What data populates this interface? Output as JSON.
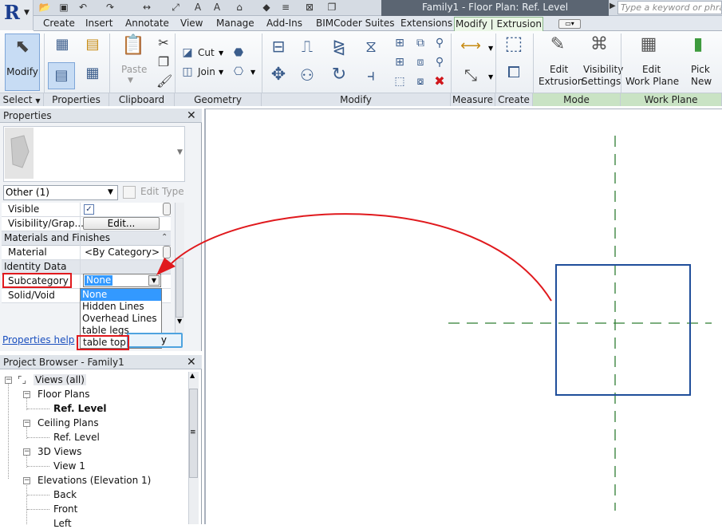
{
  "titlebar": {
    "document_title": "Family1 - Floor Plan: Ref. Level",
    "search_placeholder": "Type a keyword or phrase"
  },
  "tabs": [
    {
      "label": "Create"
    },
    {
      "label": "Insert"
    },
    {
      "label": "Annotate"
    },
    {
      "label": "View"
    },
    {
      "label": "Manage"
    },
    {
      "label": "Add-Ins"
    },
    {
      "label": "BIMCoder Suites"
    },
    {
      "label": "Extensions"
    }
  ],
  "active_tab": "Modify | Extrusion",
  "ribbon": {
    "modify_label": "Modify",
    "paste_label": "Paste",
    "cut_label": "Cut",
    "join_label": "Join",
    "edit_extrusion_line1": "Edit",
    "edit_extrusion_line2": "Extrusion",
    "visibility_line1": "Visibility",
    "visibility_line2": "Settings",
    "edit_wp_line1": "Edit",
    "edit_wp_line2": "Work Plane",
    "pick_new_line1": "Pick",
    "pick_new_line2": "New",
    "panels": {
      "select": "Select",
      "properties": "Properties",
      "clipboard": "Clipboard",
      "geometry": "Geometry",
      "modify": "Modify",
      "measure": "Measure",
      "create": "Create",
      "mode": "Mode",
      "work_plane": "Work Plane"
    }
  },
  "properties": {
    "title": "Properties",
    "type_selector": "Other (1)",
    "edit_type": "Edit Type",
    "rows": {
      "visible": "Visible",
      "visibility_graphics": "Visibility/Grap...",
      "edit_button": "Edit...",
      "materials_group": "Materials and Finishes",
      "material": "Material",
      "material_value": "<By Category>",
      "identity_group": "Identity Data",
      "subcategory": "Subcategory",
      "subcategory_value": "None",
      "solid_void": "Solid/Void"
    },
    "dropdown_options": [
      "None",
      "Hidden Lines",
      "Overhead Lines",
      "table legs",
      "table top"
    ],
    "help_link": "Properties help",
    "apply_partial": "y"
  },
  "project_browser": {
    "title": "Project Browser - Family1",
    "tree": {
      "root": "Views (all)",
      "floor_plans": "Floor Plans",
      "ref_level_bold": "Ref. Level",
      "ceiling_plans": "Ceiling Plans",
      "ceiling_ref_level": "Ref. Level",
      "views_3d": "3D Views",
      "view1": "View 1",
      "elevations": "Elevations (Elevation 1)",
      "back": "Back",
      "front": "Front",
      "left": "Left"
    }
  },
  "colors": {
    "annotation_red": "#e0191d",
    "extrusion_blue": "#1f4e9a",
    "ref_plane_green": "#2e7d32",
    "selection_blue": "#3399ff"
  }
}
